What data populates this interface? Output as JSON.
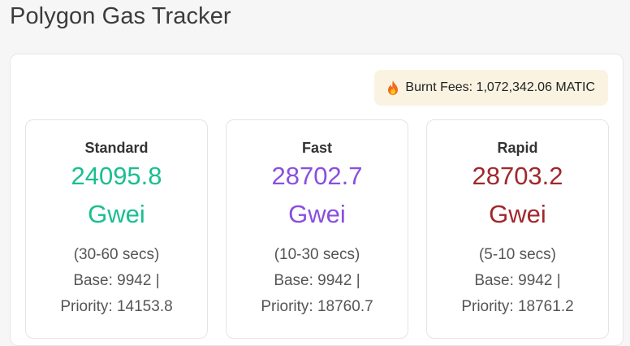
{
  "page": {
    "title": "Polygon Gas Tracker"
  },
  "burnt_fees": {
    "text": "Burnt Fees: 1,072,342.06 MATIC",
    "icon": "fire-icon"
  },
  "colors": {
    "standard": "#19bf8f",
    "fast": "#8a4fe0",
    "rapid": "#a0282d"
  },
  "tiers": [
    {
      "name": "Standard",
      "value": "24095.8",
      "unit": "Gwei",
      "time": "(30-60 secs)",
      "base": "Base: 9942 |",
      "priority": "Priority: 14153.8"
    },
    {
      "name": "Fast",
      "value": "28702.7",
      "unit": "Gwei",
      "time": "(10-30 secs)",
      "base": "Base: 9942 |",
      "priority": "Priority: 18760.7"
    },
    {
      "name": "Rapid",
      "value": "28703.2",
      "unit": "Gwei",
      "time": "(5-10 secs)",
      "base": "Base: 9942 |",
      "priority": "Priority: 18761.2"
    }
  ]
}
